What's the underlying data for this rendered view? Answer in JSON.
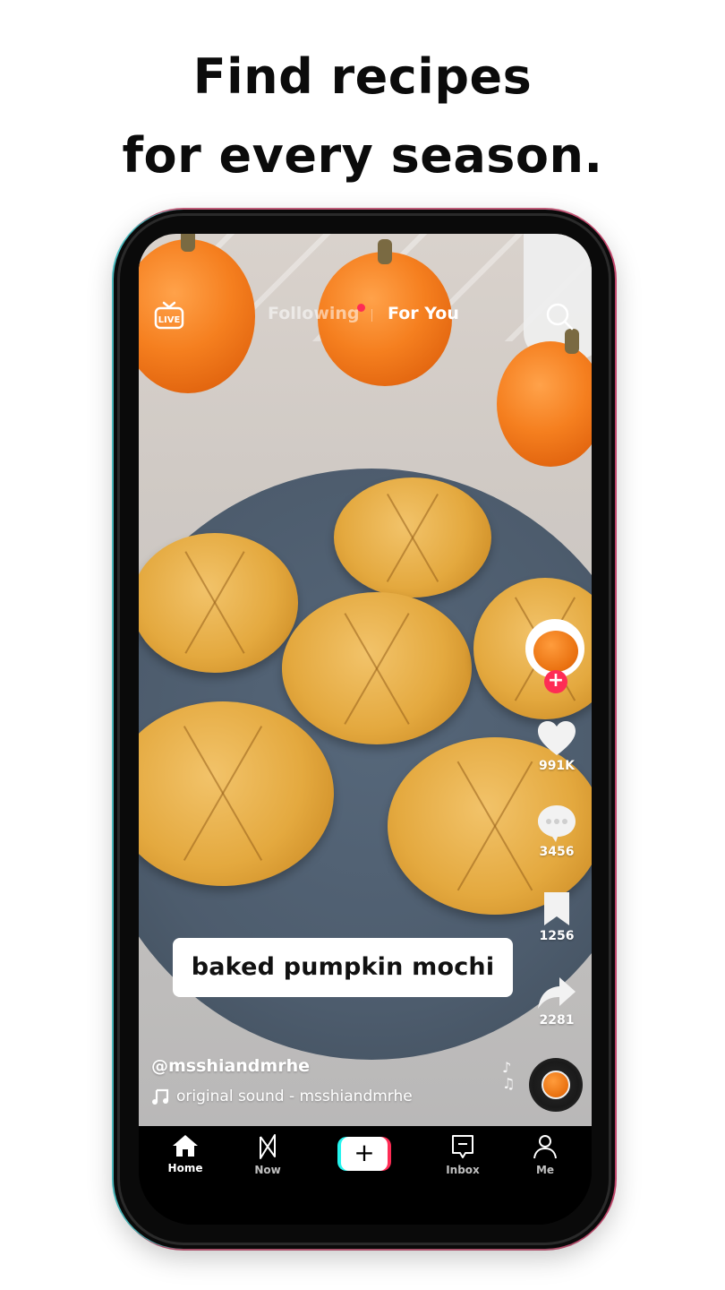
{
  "headline": {
    "line1": "Find recipes",
    "line2": "for every season."
  },
  "top_bar": {
    "live_icon": "live-tv-icon",
    "live_label": "LIVE",
    "tabs": [
      {
        "label": "Following",
        "active": false,
        "has_notification_dot": true
      },
      {
        "label": "For You",
        "active": true
      }
    ],
    "search_icon": "search-icon"
  },
  "video": {
    "caption_overlay": "baked pumpkin mochi",
    "username": "@msshiandmrhe",
    "sound": "original sound - msshiandmrhe"
  },
  "rail": {
    "follow_label": "+",
    "likes": "991K",
    "comments": "3456",
    "bookmarks": "1256",
    "shares": "2281"
  },
  "bottom_nav": {
    "items": [
      {
        "label": "Home",
        "icon": "home-icon",
        "active": true
      },
      {
        "label": "Now",
        "icon": "now-icon",
        "active": false
      },
      {
        "label": "",
        "icon": "create-plus-icon",
        "active": false
      },
      {
        "label": "Inbox",
        "icon": "inbox-icon",
        "active": false
      },
      {
        "label": "Me",
        "icon": "profile-icon",
        "active": false
      }
    ],
    "create_label": "+"
  },
  "colors": {
    "accent_red": "#fe2c55",
    "accent_cyan": "#25f4ee"
  }
}
